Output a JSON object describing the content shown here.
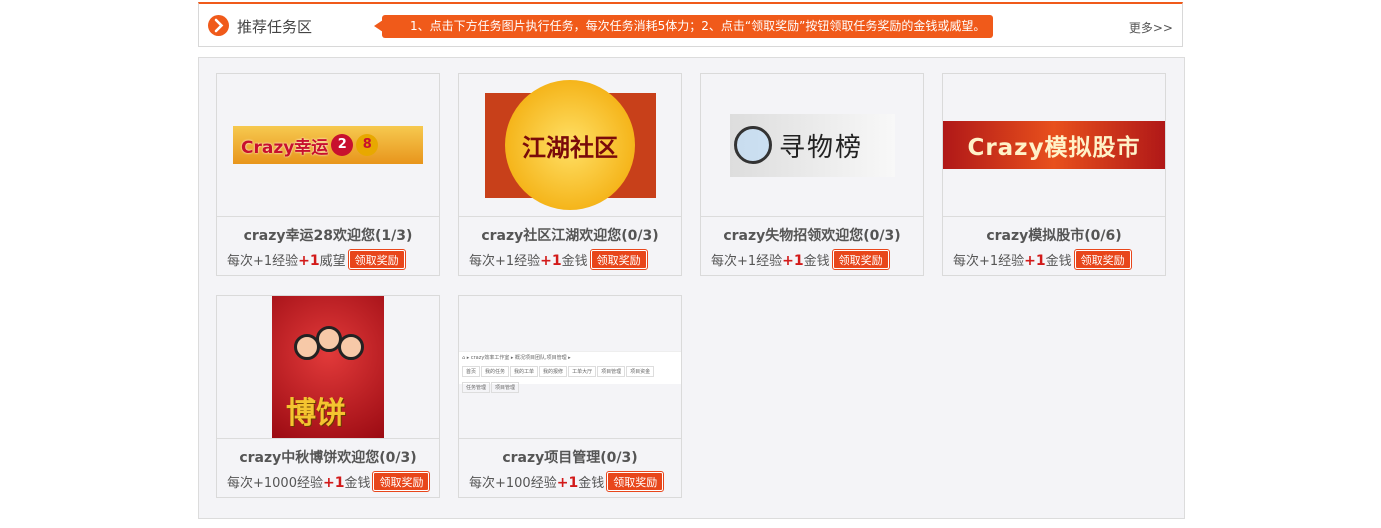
{
  "header": {
    "title": "推荐任务区",
    "notice": "1、点击下方任务图片执行任务，每次任务消耗5体力；2、点击“领取奖励”按钮领取任务奖励的金钱或威望。",
    "more": "更多>>"
  },
  "claim_label": "领取奖励",
  "tasks": [
    {
      "name": "crazy幸运28欢迎您(1/3)",
      "reward_prefix": "每次+1经验",
      "reward_bonus": "+1",
      "reward_unit": "威望",
      "banner": {
        "text": "Crazy幸运",
        "balls": [
          "2",
          "8"
        ]
      }
    },
    {
      "name": "crazy社区江湖欢迎您(0/3)",
      "reward_prefix": "每次+1经验",
      "reward_bonus": "+1",
      "reward_unit": "金钱",
      "banner": {
        "text": "江湖社区"
      }
    },
    {
      "name": "crazy失物招领欢迎您(0/3)",
      "reward_prefix": "每次+1经验",
      "reward_bonus": "+1",
      "reward_unit": "金钱",
      "banner": {
        "text": "寻物榜"
      }
    },
    {
      "name": "crazy模拟股市(0/6)",
      "reward_prefix": "每次+1经验",
      "reward_bonus": "+1",
      "reward_unit": "金钱",
      "banner": {
        "text": "Crazy模拟股市"
      }
    },
    {
      "name": "crazy中秋博饼欢迎您(0/3)",
      "reward_prefix": "每次+1000经验",
      "reward_bonus": "+1",
      "reward_unit": "金钱",
      "banner": {
        "text": "博饼"
      }
    },
    {
      "name": "crazy项目管理(0/3)",
      "reward_prefix": "每次+100经验",
      "reward_bonus": "+1",
      "reward_unit": "金钱",
      "banner": {
        "breadcrumb": "⌂ ▸ crazy效率工作室 ▸ 概况项目团队,项目管理 ▸",
        "tabs": [
          "首页",
          "我的任务",
          "我的工单",
          "我的报修",
          "工单大厅",
          "项目管理",
          "项目资金",
          "任务管理",
          "项目管理"
        ]
      }
    }
  ],
  "colors": {
    "accent": "#f05a1a",
    "bonus": "#d21a1a"
  }
}
